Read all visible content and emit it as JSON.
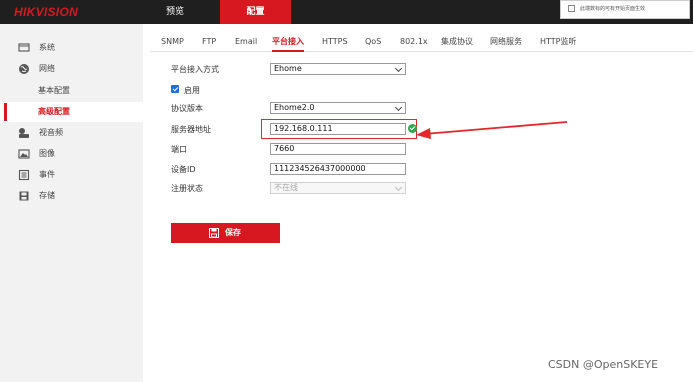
{
  "brand": {
    "logo": "HIKVISION"
  },
  "topnav": {
    "preview": "预览",
    "config": "配置"
  },
  "notice": {
    "text": "此端数标的可有开始页面生效"
  },
  "sidebar": {
    "items": [
      {
        "label": "系统",
        "icon": "monitor-icon"
      },
      {
        "label": "网络",
        "icon": "globe-icon"
      },
      {
        "label": "基本配置"
      },
      {
        "label": "高级配置"
      },
      {
        "label": "视音频",
        "icon": "camera-icon"
      },
      {
        "label": "图像",
        "icon": "image-icon"
      },
      {
        "label": "事件",
        "icon": "event-list-icon"
      },
      {
        "label": "存储",
        "icon": "save-disk-icon"
      }
    ]
  },
  "tabs": [
    "SNMP",
    "FTP",
    "Email",
    "平台接入",
    "HTTPS",
    "QoS",
    "802.1x",
    "集成协议",
    "网络服务",
    "HTTP监听"
  ],
  "form": {
    "access_mode_label": "平台接入方式",
    "access_mode_value": "Ehome",
    "enable_label": "启用",
    "protocol_label": "协议版本",
    "protocol_value": "Ehome2.0",
    "server_label": "服务器地址",
    "server_value": "192.168.0.111",
    "port_label": "端口",
    "port_value": "7660",
    "device_id_label": "设备ID",
    "device_id_value": "111234526437000000",
    "status_label": "注册状态",
    "status_value": "不在线"
  },
  "actions": {
    "save_label": "保存"
  },
  "watermark": "CSDN @OpenSKEYE",
  "colors": {
    "accent": "#d71820",
    "topbar": "#1f1f1f",
    "sidebar": "#f2f2f2",
    "annotation": "#e6262a",
    "valid": "#2fa84f"
  }
}
